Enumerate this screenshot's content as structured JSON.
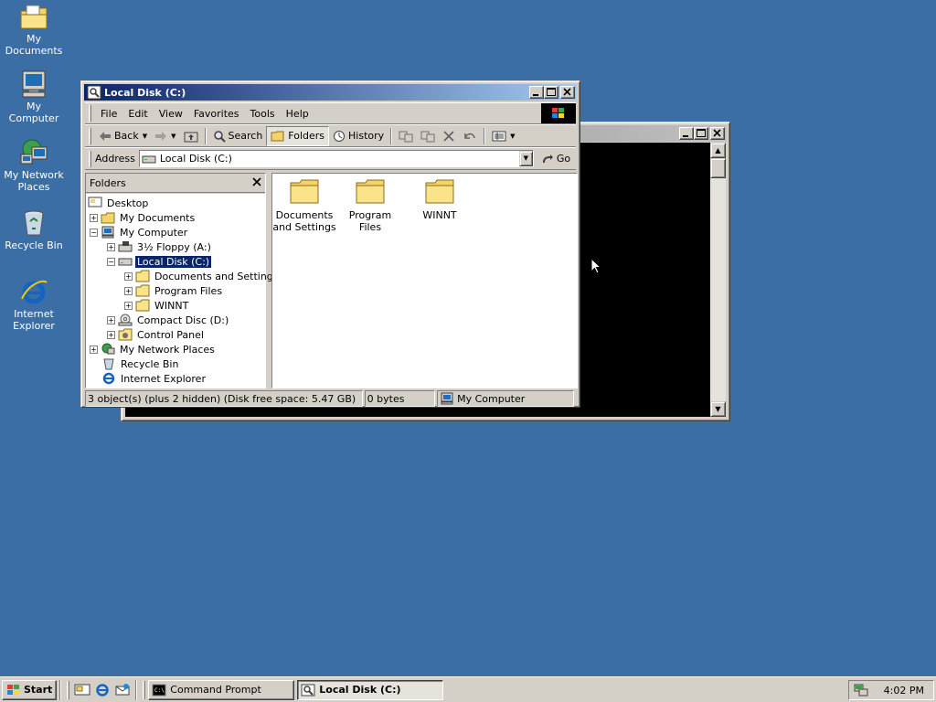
{
  "desktop": {
    "icons": [
      {
        "label": "My Documents",
        "icon": "folder-documents-icon"
      },
      {
        "label": "My Computer",
        "icon": "computer-icon"
      },
      {
        "label": "My Network Places",
        "icon": "network-icon"
      },
      {
        "label": "Recycle Bin",
        "icon": "recycle-bin-icon"
      },
      {
        "label": "Internet Explorer",
        "icon": "internet-explorer-icon"
      }
    ],
    "background_color": "#3a6ea5"
  },
  "explorer": {
    "title": "Local Disk (C:)",
    "menu": [
      "File",
      "Edit",
      "View",
      "Favorites",
      "Tools",
      "Help"
    ],
    "toolbar": {
      "back": "Back",
      "search": "Search",
      "folders": "Folders",
      "history": "History"
    },
    "address": {
      "label": "Address",
      "value": "Local Disk (C:)",
      "go": "Go"
    },
    "folders_pane": {
      "title": "Folders",
      "tree": [
        {
          "label": "Desktop"
        },
        {
          "label": "My Documents"
        },
        {
          "label": "My Computer"
        },
        {
          "label": "3½ Floppy (A:)"
        },
        {
          "label": "Local Disk (C:)",
          "selected": true
        },
        {
          "label": "Documents and Settings"
        },
        {
          "label": "Program Files"
        },
        {
          "label": "WINNT"
        },
        {
          "label": "Compact Disc (D:)"
        },
        {
          "label": "Control Panel"
        },
        {
          "label": "My Network Places"
        },
        {
          "label": "Recycle Bin"
        },
        {
          "label": "Internet Explorer"
        }
      ]
    },
    "files": [
      {
        "line1": "Documents",
        "line2": "and Settings"
      },
      {
        "line1": "Program Files",
        "line2": ""
      },
      {
        "line1": "WINNT",
        "line2": ""
      }
    ],
    "status": {
      "objects": "3 object(s) (plus 2 hidden) (Disk free space: 5.47 GB)",
      "size": "0 bytes",
      "zone": "My Computer"
    }
  },
  "cmd_window": {
    "title": ""
  },
  "taskbar": {
    "start": "Start",
    "tasks": [
      {
        "label": "Command Prompt",
        "active": false
      },
      {
        "label": "Local Disk (C:)",
        "active": true
      }
    ],
    "clock": "4:02 PM"
  }
}
